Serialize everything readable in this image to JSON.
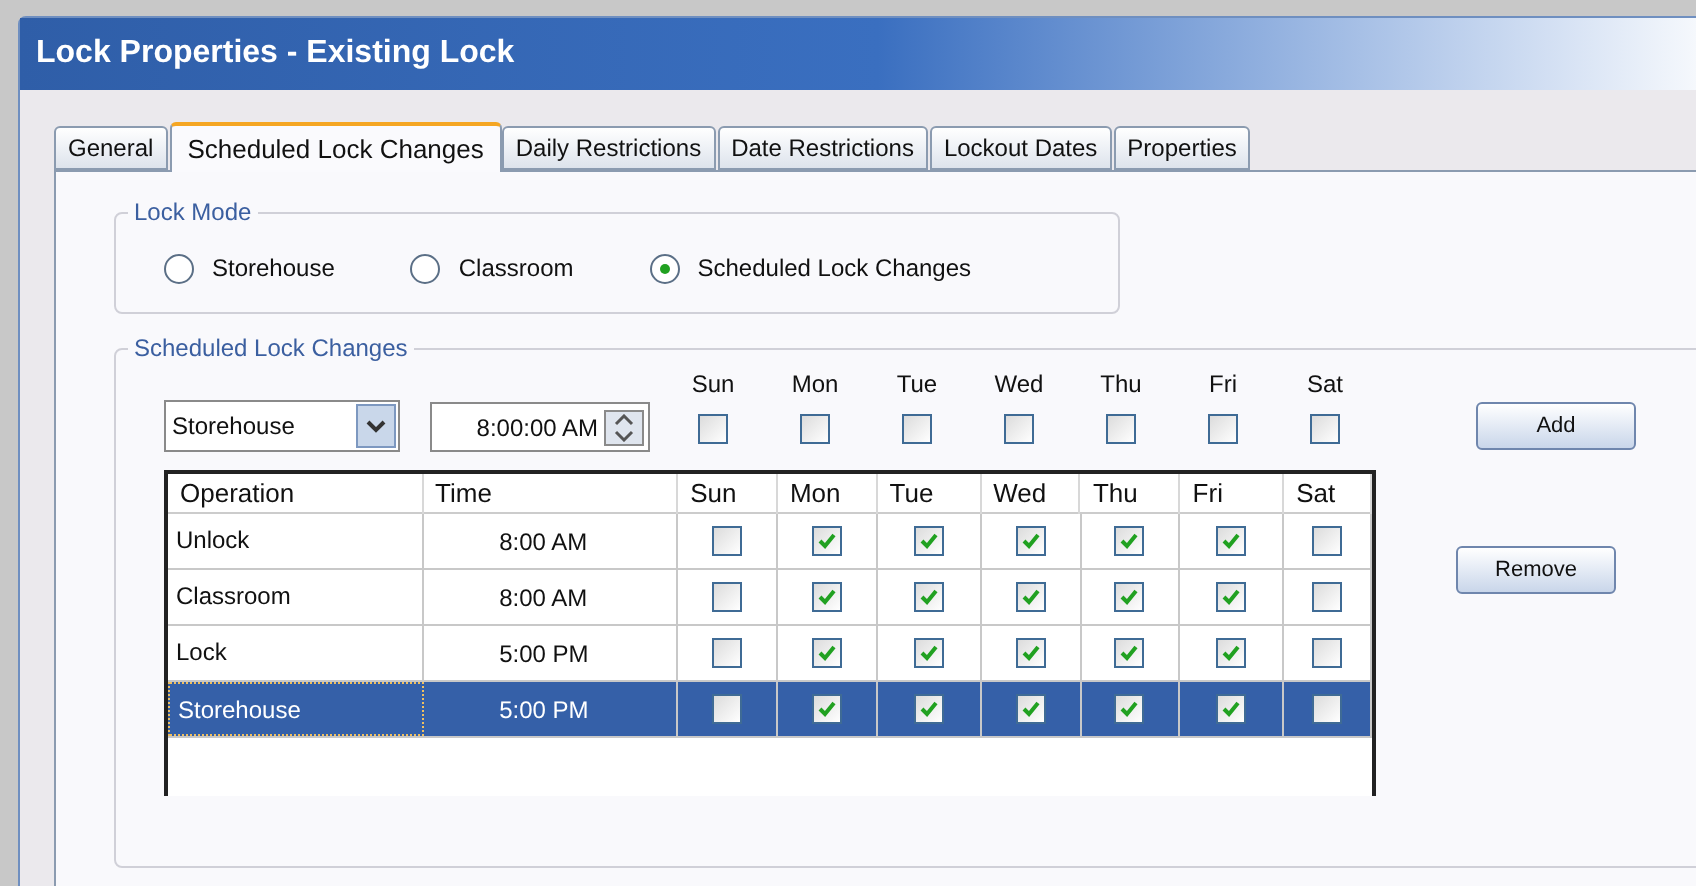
{
  "window": {
    "title": "Lock Properties - Existing Lock"
  },
  "tabs": [
    {
      "label": "General",
      "selected": false
    },
    {
      "label": "Scheduled Lock Changes",
      "selected": true
    },
    {
      "label": "Daily Restrictions",
      "selected": false
    },
    {
      "label": "Date Restrictions",
      "selected": false
    },
    {
      "label": "Lockout Dates",
      "selected": false
    },
    {
      "label": "Properties",
      "selected": false
    }
  ],
  "lock_mode": {
    "title": "Lock Mode",
    "options": [
      {
        "label": "Storehouse",
        "selected": false
      },
      {
        "label": "Classroom",
        "selected": false
      },
      {
        "label": "Scheduled Lock Changes",
        "selected": true
      }
    ]
  },
  "scheduled": {
    "title": "Scheduled Lock Changes",
    "operation_select": {
      "value": "Storehouse"
    },
    "time_field": {
      "value": "8:00:00 AM"
    },
    "days": [
      {
        "label": "Sun",
        "checked": false
      },
      {
        "label": "Mon",
        "checked": false
      },
      {
        "label": "Tue",
        "checked": false
      },
      {
        "label": "Wed",
        "checked": false
      },
      {
        "label": "Thu",
        "checked": false
      },
      {
        "label": "Fri",
        "checked": false
      },
      {
        "label": "Sat",
        "checked": false
      }
    ],
    "buttons": [
      "Add",
      "Remove"
    ],
    "table": {
      "columns": [
        "Operation",
        "Time",
        "Sun",
        "Mon",
        "Tue",
        "Wed",
        "Thu",
        "Fri",
        "Sat"
      ],
      "rows": [
        {
          "operation": "Unlock",
          "time": "8:00 AM",
          "days": [
            false,
            true,
            true,
            true,
            true,
            true,
            false
          ],
          "selected": false
        },
        {
          "operation": "Classroom",
          "time": "8:00 AM",
          "days": [
            false,
            true,
            true,
            true,
            true,
            true,
            false
          ],
          "selected": false
        },
        {
          "operation": "Lock",
          "time": "5:00 PM",
          "days": [
            false,
            true,
            true,
            true,
            true,
            true,
            false
          ],
          "selected": false
        },
        {
          "operation": "Storehouse",
          "time": "5:00 PM",
          "days": [
            false,
            true,
            true,
            true,
            true,
            true,
            false
          ],
          "selected": true
        }
      ]
    }
  }
}
